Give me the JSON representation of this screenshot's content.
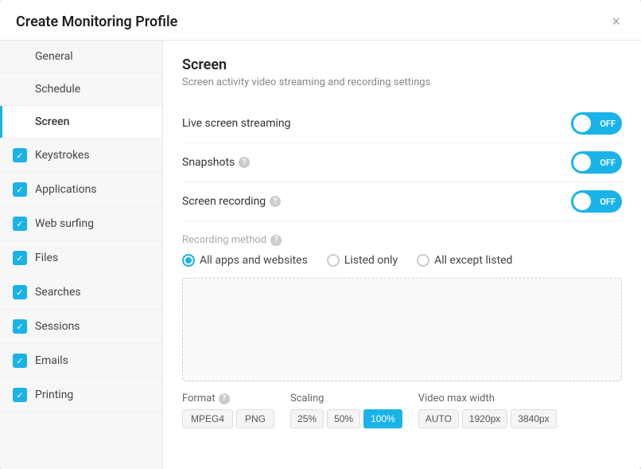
{
  "dialog": {
    "title": "Create Monitoring Profile",
    "close_label": "×"
  },
  "sidebar": {
    "items": [
      {
        "id": "general",
        "label": "General",
        "has_check": false,
        "active": false
      },
      {
        "id": "schedule",
        "label": "Schedule",
        "has_check": false,
        "active": false
      },
      {
        "id": "screen",
        "label": "Screen",
        "has_check": false,
        "active": true
      },
      {
        "id": "keystrokes",
        "label": "Keystrokes",
        "has_check": true,
        "active": false
      },
      {
        "id": "applications",
        "label": "Applications",
        "has_check": true,
        "active": false
      },
      {
        "id": "web-surfing",
        "label": "Web surfing",
        "has_check": true,
        "active": false
      },
      {
        "id": "files",
        "label": "Files",
        "has_check": true,
        "active": false
      },
      {
        "id": "searches",
        "label": "Searches",
        "has_check": true,
        "active": false
      },
      {
        "id": "sessions",
        "label": "Sessions",
        "has_check": true,
        "active": false
      },
      {
        "id": "emails",
        "label": "Emails",
        "has_check": true,
        "active": false
      },
      {
        "id": "printing",
        "label": "Printing",
        "has_check": true,
        "active": false
      }
    ]
  },
  "main": {
    "section_title": "Screen",
    "section_subtitle": "Screen activity video streaming and recording settings",
    "settings": [
      {
        "id": "live-streaming",
        "label": "Live screen streaming",
        "has_help": false,
        "toggle_state": "OFF"
      },
      {
        "id": "snapshots",
        "label": "Snapshots",
        "has_help": true,
        "toggle_state": "OFF"
      },
      {
        "id": "screen-recording",
        "label": "Screen recording",
        "has_help": true,
        "toggle_state": "OFF"
      }
    ],
    "recording_method": {
      "title": "Recording method",
      "has_help": true,
      "options": [
        {
          "id": "all-apps",
          "label": "All apps and websites",
          "selected": true
        },
        {
          "id": "listed-only",
          "label": "Listed only",
          "selected": false
        },
        {
          "id": "all-except",
          "label": "All except listed",
          "selected": false
        }
      ]
    },
    "format": {
      "title": "Format",
      "has_help": true,
      "buttons": [
        {
          "label": "MPEG4",
          "active": false
        },
        {
          "label": "PNG",
          "active": false
        }
      ]
    },
    "scaling": {
      "title": "Scaling",
      "buttons": [
        {
          "label": "25%",
          "active": false
        },
        {
          "label": "50%",
          "active": false
        },
        {
          "label": "100%",
          "active": true
        }
      ]
    },
    "video_max_width": {
      "title": "Video max width",
      "buttons": [
        {
          "label": "AUTO",
          "active": false
        },
        {
          "label": "1920px",
          "active": false
        },
        {
          "label": "3840px",
          "active": false
        }
      ]
    }
  }
}
